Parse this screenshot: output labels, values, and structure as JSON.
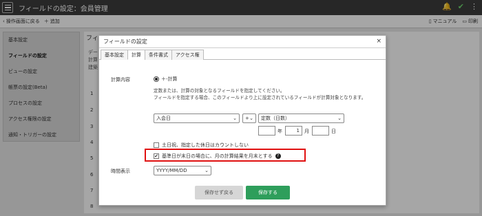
{
  "app": {
    "title": "フィールドの設定：会員管理"
  },
  "toolbar": {
    "back_label": "操作画面に戻る",
    "add_label": "追加",
    "manual_label": "マニュアル",
    "print_label": "印刷"
  },
  "sidebar": {
    "items": [
      {
        "label": "基本設定"
      },
      {
        "label": "フィールドの設定"
      },
      {
        "label": "ビューの設定"
      },
      {
        "label": "帳票の設定(Beta)"
      },
      {
        "label": "プロセスの設定"
      },
      {
        "label": "アクセス権限の設定"
      },
      {
        "label": "通知・トリガーの設定"
      }
    ]
  },
  "background": {
    "heading": "フィ",
    "sub1": "デー",
    "sub2": "計算",
    "sub3": "建築",
    "rows": [
      "1",
      "2",
      "3",
      "4",
      "5",
      "6",
      "7",
      "8"
    ]
  },
  "dialog": {
    "title": "フィールドの設定",
    "close": "×",
    "tabs": [
      {
        "label": "基本設定"
      },
      {
        "label": "計算"
      },
      {
        "label": "条件書式"
      },
      {
        "label": "アクセス権"
      }
    ],
    "calc_label": "計算内容",
    "calc_radio": "＋-計算",
    "desc_line1": "定数または、計算の対象となるフィールドを指定してください。",
    "desc_line2": "フィールドを指定する場合、このフィールドより上に設定されているフィールドが計算対象となります。",
    "field_select": "入会日",
    "operator_select": "+",
    "const_select": "定数（日数）",
    "year_value": "",
    "year_unit": "年",
    "month_value": "1",
    "month_unit": "月",
    "day_value": "",
    "day_unit": "日",
    "holiday_checkbox": "土日祝、指定した休日はカウントしない",
    "month_end_checkbox": "基準日が末日の場合に、月の計算結果を月末とする",
    "time_label": "時間表示",
    "time_format": "YYYY/MM/DD",
    "cancel_button": "保存せず戻る",
    "save_button": "保存する"
  },
  "colors": {
    "save": "#2e9e5b",
    "highlight": "#e01010",
    "appbar": "#3d3d3d"
  }
}
